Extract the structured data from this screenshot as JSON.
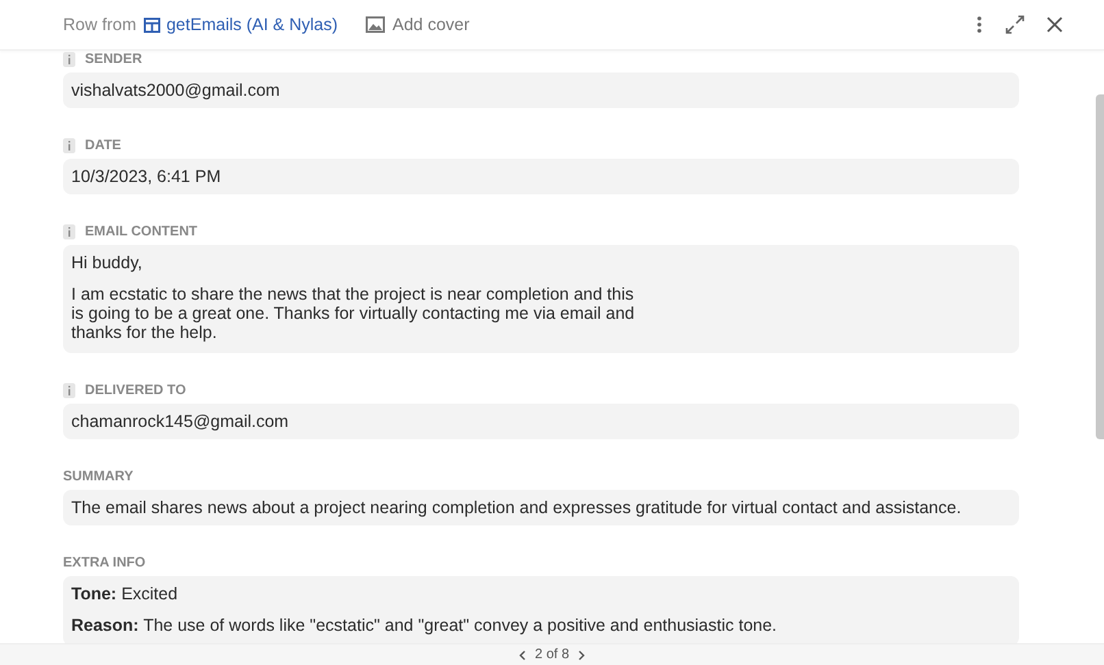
{
  "header": {
    "prefix": "Row from",
    "table_name": "getEmails (AI & Nylas)",
    "add_cover": "Add cover"
  },
  "fields": [
    {
      "label": "SENDER",
      "info": true,
      "kind": "text",
      "value": "vishalvats2000@gmail.com"
    },
    {
      "label": "DATE",
      "info": true,
      "kind": "text",
      "value": "10/3/2023, 6:41 PM"
    },
    {
      "label": "EMAIL CONTENT",
      "info": true,
      "kind": "paragraphs",
      "paragraphs": [
        "Hi buddy,",
        "I am ecstatic to share the news that the project is near completion and this is going to be a great one. Thanks for virtually contacting me via email and thanks for the help."
      ]
    },
    {
      "label": "DELIVERED TO",
      "info": true,
      "kind": "text",
      "value": "chamanrock145@gmail.com"
    },
    {
      "label": "SUMMARY",
      "info": false,
      "kind": "text",
      "value": "The email shares news about a project nearing completion and expresses gratitude for virtual contact and assistance."
    },
    {
      "label": "EXTRA INFO",
      "info": false,
      "kind": "paragraphs",
      "paragraphs": [
        "**Tone:** Excited",
        "**Reason:** The use of words like \"ecstatic\" and \"great\" convey a positive and enthusiastic tone."
      ]
    }
  ],
  "pager": {
    "text": "2 of 8"
  }
}
